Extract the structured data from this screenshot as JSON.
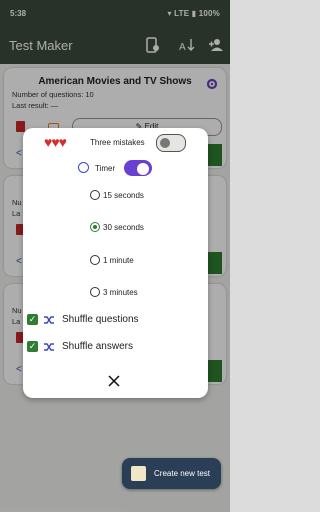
{
  "status_bar": {
    "time": "5:38",
    "network": "LTE",
    "battery": "100%"
  },
  "app_bar": {
    "title": "Test Maker"
  },
  "cards": [
    {
      "title": "American Movies and TV Shows",
      "questions": "Number of questions: 10",
      "last_result": "Last result: —",
      "edit_label": "Edit"
    },
    {
      "questions_partial": "Nu",
      "last_partial": "La"
    },
    {
      "questions_partial": "Nu",
      "last_partial": "La"
    }
  ],
  "dialog": {
    "mistakes_label": "Three mistakes",
    "mistakes_enabled": false,
    "timer_label": "Timer",
    "timer_enabled": true,
    "timer_options": [
      {
        "label": "15 seconds",
        "selected": false
      },
      {
        "label": "30 seconds",
        "selected": true
      },
      {
        "label": "1 minute",
        "selected": false
      },
      {
        "label": "3 minutes",
        "selected": false
      }
    ],
    "shuffle_questions_label": "Shuffle questions",
    "shuffle_questions_checked": true,
    "shuffle_answers_label": "Shuffle answers",
    "shuffle_answers_checked": true
  },
  "fab": {
    "label": "Create new test"
  },
  "colors": {
    "app_bar": "#3c4a3d",
    "accent_green": "#2e7d32",
    "accent_purple": "#6a3fd1",
    "fab": "#2a3e56"
  }
}
